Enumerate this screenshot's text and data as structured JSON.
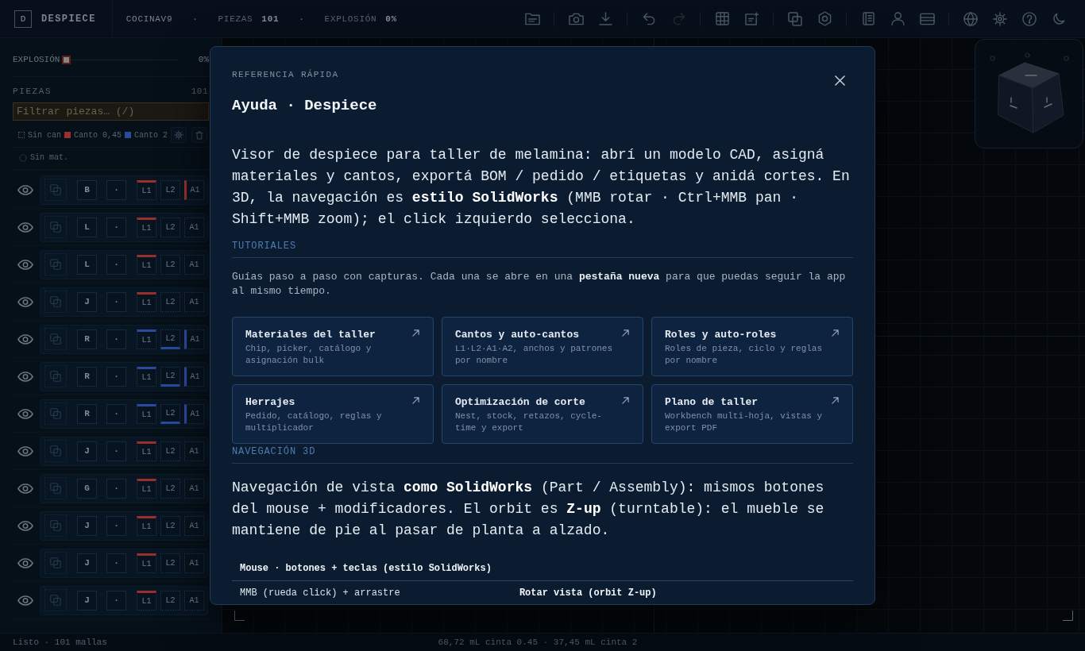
{
  "topbar": {
    "logo": "D",
    "app_name": "DESPIECE",
    "items": [
      {
        "kind": "project",
        "value": "COCINAV9"
      },
      {
        "kind": "separator",
        "value": "·"
      },
      {
        "kind": "stat",
        "label": "PIEZAS",
        "value": "101"
      },
      {
        "kind": "separator",
        "value": "·"
      },
      {
        "kind": "stat",
        "label": "EXPLOSIÓN",
        "value": "0%"
      }
    ],
    "toolbar": [
      [
        {
          "disabled": false
        }
      ],
      [
        {
          "disabled": false
        },
        {
          "disabled": false
        }
      ],
      [
        {
          "disabled": false
        },
        {
          "disabled": true
        }
      ],
      [
        {
          "disabled": false
        },
        {
          "disabled": false
        }
      ],
      [
        {
          "disabled": false
        },
        {
          "disabled": false
        }
      ],
      [
        {
          "disabled": false
        },
        {
          "disabled": false
        },
        {
          "disabled": false
        }
      ],
      [
        {
          "disabled": false
        },
        {
          "disabled": false
        },
        {
          "disabled": false
        },
        {
          "disabled": false
        }
      ]
    ]
  },
  "sidebar": {
    "explosion": {
      "label": "EXPLOSIÓN",
      "level": 0,
      "reading": "0%"
    },
    "pieces": {
      "title": "PIEZAS",
      "count": "101",
      "filter": {
        "placeholder": "Filtrar piezas… (/)"
      },
      "legend": [
        {
          "label": "Sin can"
        },
        {
          "label": "Canto 0,45",
          "color": "#992f2f"
        },
        {
          "label": "Canto 2",
          "color": "#2a4a9e"
        }
      ],
      "no_material": "Sin mat.",
      "rows": [
        {
          "visible": true,
          "role": "B",
          "material": "·",
          "edges": [
            {
              "label": "L1",
              "color": "#992f2f"
            },
            {
              "label": "L2"
            },
            {
              "label": "A1",
              "color": "#992f2f"
            }
          ]
        },
        {
          "visible": true,
          "role": "L",
          "material": "·",
          "edges": [
            {
              "label": "L1",
              "color": "#992f2f"
            },
            {
              "label": "L2"
            },
            {
              "label": "A1"
            }
          ]
        },
        {
          "visible": true,
          "role": "L",
          "material": "·",
          "edges": [
            {
              "label": "L1",
              "color": "#992f2f"
            },
            {
              "label": "L2"
            },
            {
              "label": "A1"
            }
          ]
        },
        {
          "visible": true,
          "role": "J",
          "material": "·",
          "edges": [
            {
              "label": "L1",
              "color": "#992f2f"
            },
            {
              "label": "L2"
            },
            {
              "label": "A1"
            }
          ]
        },
        {
          "visible": true,
          "role": "R",
          "material": "·",
          "edges": [
            {
              "label": "L1",
              "color": "#2a4a9e"
            },
            {
              "label": "L2",
              "color": "#2a4a9e"
            },
            {
              "label": "A1",
              "color": "#2a4a9e"
            }
          ]
        },
        {
          "visible": true,
          "role": "R",
          "material": "·",
          "edges": [
            {
              "label": "L1",
              "color": "#2a4a9e"
            },
            {
              "label": "L2",
              "color": "#2a4a9e"
            },
            {
              "label": "A1",
              "color": "#2a4a9e"
            }
          ]
        },
        {
          "visible": true,
          "role": "R",
          "material": "·",
          "edges": [
            {
              "label": "L1",
              "color": "#2a4a9e"
            },
            {
              "label": "L2",
              "color": "#2a4a9e"
            },
            {
              "label": "A1",
              "color": "#2a4a9e"
            }
          ]
        },
        {
          "visible": true,
          "role": "J",
          "material": "·",
          "edges": [
            {
              "label": "L1",
              "color": "#992f2f"
            },
            {
              "label": "L2"
            },
            {
              "label": "A1"
            }
          ]
        },
        {
          "visible": true,
          "role": "G",
          "material": "·",
          "edges": [
            {
              "label": "L1",
              "color": "#992f2f"
            },
            {
              "label": "L2"
            },
            {
              "label": "A1"
            }
          ]
        },
        {
          "visible": true,
          "role": "J",
          "material": "·",
          "edges": [
            {
              "label": "L1",
              "color": "#992f2f"
            },
            {
              "label": "L2"
            },
            {
              "label": "A1"
            }
          ]
        },
        {
          "visible": true,
          "role": "J",
          "material": "·",
          "edges": [
            {
              "label": "L1",
              "color": "#992f2f"
            },
            {
              "label": "L2"
            },
            {
              "label": "A1"
            }
          ]
        },
        {
          "visible": true,
          "role": "J",
          "material": "·",
          "edges": [
            {
              "label": "L1",
              "color": "#992f2f"
            },
            {
              "label": "L2"
            },
            {
              "label": "A1"
            }
          ]
        }
      ]
    }
  },
  "dialog": {
    "eyebrow": "REFERENCIA RÁPIDA",
    "title": "Ayuda · Despiece",
    "intro": "Visor de despiece para taller de melamina: abrí un modelo CAD, asigná materiales y cantos, exportá BOM / pedido / etiquetas y anidá cortes. En 3D, la navegación es **estilo SolidWorks** (MMB rotar · Ctrl+MMB pan · Shift+MMB zoom); el click izquierdo selecciona.",
    "sections": [
      {
        "kind": "cards",
        "heading": "TUTORIALES",
        "text": "Guías paso a paso con capturas. Cada una se abre en una **pestaña nueva** para que puedas seguir la app al mismo tiempo.",
        "cards": [
          {
            "title": "Materiales del taller",
            "description": "Chip, picker, catálogo y asignación bulk"
          },
          {
            "title": "Cantos y auto-cantos",
            "description": "L1·L2·A1·A2, anchos y patrones por nombre"
          },
          {
            "title": "Roles y auto-roles",
            "description": "Roles de pieza, ciclo y reglas por nombre"
          },
          {
            "title": "Herrajes",
            "description": "Pedido, catálogo, reglas y multiplicador"
          },
          {
            "title": "Optimización de corte",
            "description": "Nest, stock, retazos, cycle-time y export"
          },
          {
            "title": "Plano de taller",
            "description": "Workbench multi-hoja, vistas y export PDF"
          }
        ]
      },
      {
        "kind": "table",
        "heading": "NAVEGACIÓN 3D",
        "text": "Navegación de vista **como SolidWorks** (Part / Assembly): mismos botones del mouse + modificadores. El orbit es **Z-up** (turntable): el mueble se mantiene de pie al pasar de planta a alzado.",
        "table": {
          "caption": "Mouse · botones + teclas (estilo SolidWorks)",
          "rows": [
            {
              "input": "MMB (rueda click) + arrastre",
              "action": "Rotar vista (orbit Z-up)"
            }
          ]
        }
      }
    ]
  },
  "status_bar": {
    "left": "Listo · 101 mallas",
    "center": "68,72 mL cinta 0.45 · 37,45 mL cinta 2"
  }
}
